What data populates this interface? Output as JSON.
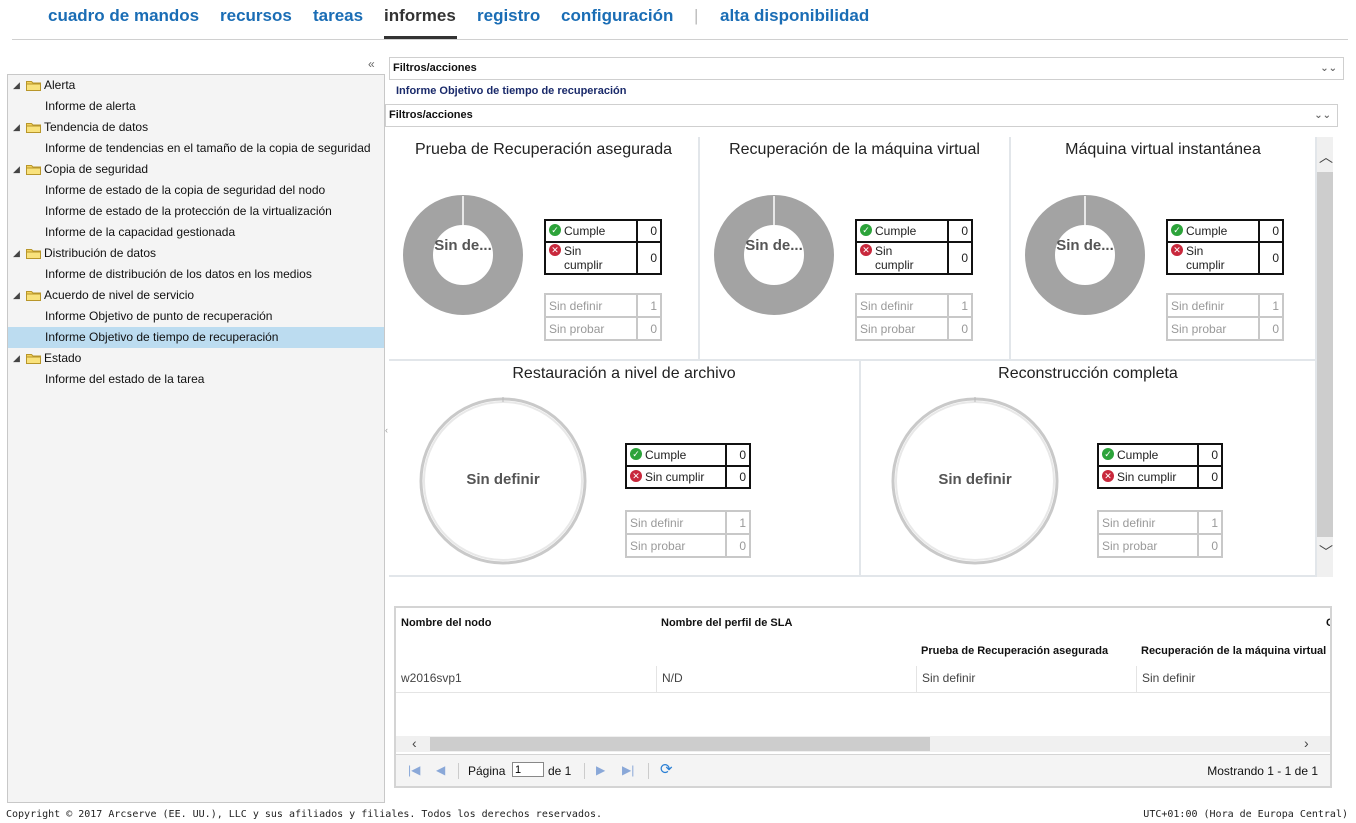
{
  "nav": {
    "items": [
      "cuadro de mandos",
      "recursos",
      "tareas",
      "informes",
      "registro",
      "configuración",
      "alta disponibilidad"
    ],
    "separator": "|",
    "active": "informes"
  },
  "sidebar": {
    "tree": [
      {
        "label": "Alerta",
        "type": "folder"
      },
      {
        "label": "Informe de alerta",
        "type": "item"
      },
      {
        "label": "Tendencia de datos",
        "type": "folder"
      },
      {
        "label": "Informe de tendencias en el tamaño de la copia de seguridad",
        "type": "item"
      },
      {
        "label": "Copia de seguridad",
        "type": "folder"
      },
      {
        "label": "Informe de estado de la copia de seguridad del nodo",
        "type": "item"
      },
      {
        "label": "Informe de estado de la protección de la virtualización",
        "type": "item"
      },
      {
        "label": "Informe de la capacidad gestionada",
        "type": "item"
      },
      {
        "label": "Distribución de datos",
        "type": "folder"
      },
      {
        "label": "Informe de distribución de los datos en los medios",
        "type": "item"
      },
      {
        "label": "Acuerdo de nivel de servicio",
        "type": "folder"
      },
      {
        "label": "Informe Objetivo de punto de recuperación",
        "type": "item"
      },
      {
        "label": "Informe Objetivo de tiempo de recuperación",
        "type": "item",
        "selected": true
      },
      {
        "label": "Estado",
        "type": "folder"
      },
      {
        "label": "Informe del estado de la tarea",
        "type": "item"
      }
    ]
  },
  "filters": {
    "outer_label": "Filtros/acciones",
    "inner_label": "Filtros/acciones"
  },
  "report_title": "Informe Objetivo de tiempo de recuperación",
  "panels": [
    {
      "title": "Prueba de Recuperación asegurada",
      "ring_label": "Sin de...",
      "cumple_label": "Cumple",
      "cumple": "0",
      "sin_cumplir_label": "Sin cumplir",
      "sin_cumplir": "0",
      "sin_definir_label": "Sin definir",
      "sin_definir": "1",
      "sin_probar_label": "Sin probar",
      "sin_probar": "0"
    },
    {
      "title": "Recuperación de la máquina virtual",
      "ring_label": "Sin de...",
      "cumple_label": "Cumple",
      "cumple": "0",
      "sin_cumplir_label": "Sin cumplir",
      "sin_cumplir": "0",
      "sin_definir_label": "Sin definir",
      "sin_definir": "1",
      "sin_probar_label": "Sin probar",
      "sin_probar": "0"
    },
    {
      "title": "Máquina virtual instantánea",
      "ring_label": "Sin de...",
      "cumple_label": "Cumple",
      "cumple": "0",
      "sin_cumplir_label": "Sin cumplir",
      "sin_cumplir": "0",
      "sin_definir_label": "Sin definir",
      "sin_definir": "1",
      "sin_probar_label": "Sin probar",
      "sin_probar": "0"
    },
    {
      "title": "Restauración a nivel de archivo",
      "ring_label": "Sin definir",
      "cumple_label": "Cumple",
      "cumple": "0",
      "sin_cumplir_label": "Sin cumplir",
      "sin_cumplir": "0",
      "sin_definir_label": "Sin definir",
      "sin_definir": "1",
      "sin_probar_label": "Sin probar",
      "sin_probar": "0"
    },
    {
      "title": "Reconstrucción completa",
      "ring_label": "Sin definir",
      "cumple_label": "Cumple",
      "cumple": "0",
      "sin_cumplir_label": "Sin cumplir",
      "sin_cumplir": "0",
      "sin_definir_label": "Sin definir",
      "sin_definir": "1",
      "sin_probar_label": "Sin probar",
      "sin_probar": "0"
    }
  ],
  "colors": {
    "nav_link": "#1a6db5",
    "ring_gray": "#a3a3a3",
    "ok_green": "#2ca33a",
    "bad_red": "#c8283c",
    "selected_row": "#bcdcf0"
  },
  "grid": {
    "col_node": "Nombre del nodo",
    "col_sla": "Nombre del perfil de SLA",
    "col_cut": "C",
    "sub_col_1": "Prueba de Recuperación asegurada",
    "sub_col_2": "Recuperación de la máquina virtual",
    "rows": [
      {
        "node": "w2016svp1",
        "sla": "N/D",
        "c1": "Sin definir",
        "c2": "Sin definir"
      }
    ]
  },
  "pager": {
    "page_label": "Página",
    "page_value": "1",
    "of_label": "de 1",
    "showing": "Mostrando 1 - 1 de 1"
  },
  "footer": {
    "copyright": "Copyright © 2017 Arcserve (EE. UU.), LLC y sus afiliados y filiales. Todos los derechos reservados.",
    "timezone": "UTC+01:00 (Hora de Europa Central)"
  }
}
